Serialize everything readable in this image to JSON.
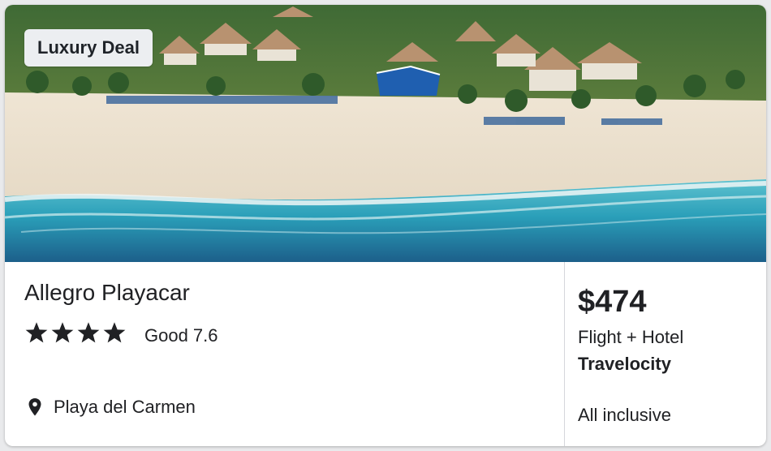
{
  "badge": {
    "label": "Luxury Deal"
  },
  "hotel": {
    "name": "Allegro Playacar",
    "star_count": 4,
    "rating_text": "Good 7.6",
    "location": "Playa del Carmen",
    "image": "aerial beach resort photo"
  },
  "pricing": {
    "price": "$474",
    "package": "Flight + Hotel",
    "provider": "Travelocity",
    "board": "All inclusive"
  },
  "icons": {
    "star": "star-icon",
    "location": "location-pin-icon"
  },
  "colors": {
    "text": "#202124",
    "badge_bg": "#eceef1",
    "divider": "#d5d7db"
  }
}
